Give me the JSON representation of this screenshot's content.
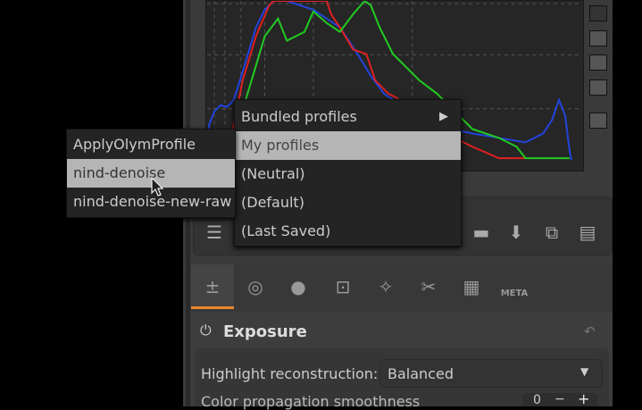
{
  "profile_menu": {
    "items": [
      {
        "label": "Bundled profiles",
        "has_submenu": true
      },
      {
        "label": "My profiles"
      },
      {
        "label": "(Neutral)"
      },
      {
        "label": "(Default)"
      },
      {
        "label": "(Last Saved)"
      }
    ]
  },
  "submenu": {
    "items": [
      {
        "label": "ApplyOlymProfile"
      },
      {
        "label": "nind-denoise"
      },
      {
        "label": "nind-denoise-new-raw"
      }
    ]
  },
  "tabs": {
    "meta_label": "META"
  },
  "exposure": {
    "title": "Exposure",
    "highlight_label": "Highlight reconstruction:",
    "highlight_value": "Balanced",
    "smoothness_label": "Color propagation smoothness",
    "smoothness_value": "0"
  },
  "colors": {
    "accent": "#e8892e",
    "selected": "#b5b5b5"
  }
}
